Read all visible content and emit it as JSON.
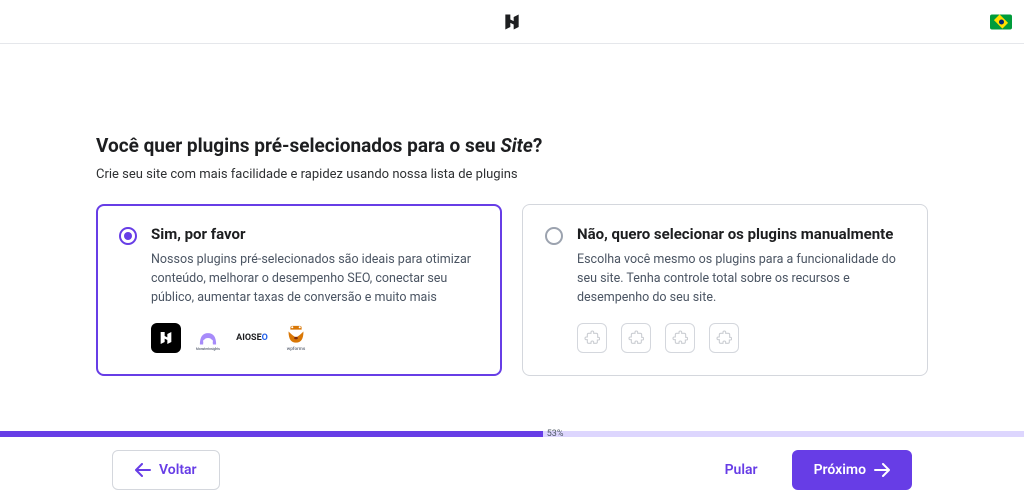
{
  "header": {
    "locale_flag": "brazil-flag"
  },
  "heading_prefix": "Você quer plugins pré-selecionados para o seu ",
  "heading_emph": "Site",
  "heading_suffix": "?",
  "subheading": "Crie seu site com mais facilidade e rapidez usando nossa lista de plugins",
  "options": {
    "yes": {
      "title": "Sim, por favor",
      "desc": "Nossos plugins pré-selecionados são ideais para otimizar conteúdo, melhorar o desempenho SEO, conectar seu público, aumentar taxas de conversão e muito mais",
      "selected": true,
      "plugins": [
        "hostinger",
        "MonsterInsights",
        "AIOSEO",
        "wpforms"
      ]
    },
    "no": {
      "title": "Não, quero selecionar os plugins manualmente",
      "desc": "Escolha você mesmo os plugins para a funcionalidade do seu site. Tenha controle total sobre os recursos e desempenho do seu site.",
      "selected": false
    }
  },
  "progress": {
    "percent_label": "53%",
    "percent": 53
  },
  "footer": {
    "back": "Voltar",
    "skip": "Pular",
    "next": "Próximo"
  },
  "colors": {
    "accent": "#673de6",
    "border": "#d4d7dd"
  }
}
